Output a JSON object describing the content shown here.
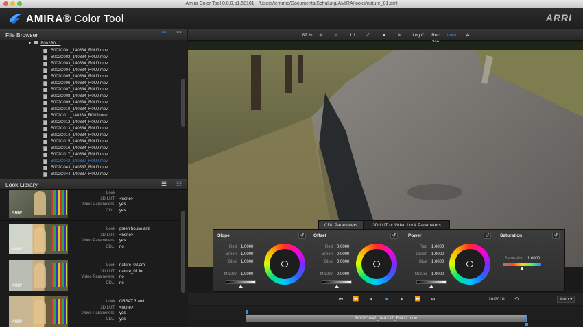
{
  "window": {
    "title": "Amira Color Tool 0.0.0.b1.58101 - /Users/temmie/Documents/Schulung/AMIRA/looks/nature_01.aml"
  },
  "brand": {
    "name_bold": "AMIRA",
    "name_reg": "® Color Tool",
    "vendor": "ARRI"
  },
  "file_browser": {
    "title": "File Browser",
    "folder": "B002R0UJ",
    "files": [
      {
        "name": "B002C001_140334_R0UJ.mov",
        "selected": false
      },
      {
        "name": "B002C002_140334_R0UJ.mov",
        "selected": false
      },
      {
        "name": "B002C003_140334_R0UJ.mov",
        "selected": false
      },
      {
        "name": "B002C004_140334_R0UJ.mov",
        "selected": false
      },
      {
        "name": "B002C005_140334_R0UJ.mov",
        "selected": false
      },
      {
        "name": "B002C006_140334_R0UJ.mov",
        "selected": false
      },
      {
        "name": "B002C007_140334_R0UJ.mov",
        "selected": false
      },
      {
        "name": "B002C008_140334_R0UJ.mov",
        "selected": false
      },
      {
        "name": "B002C009_140334_R0UJ.mov",
        "selected": false
      },
      {
        "name": "B002C010_140334_R0UJ.mov",
        "selected": false
      },
      {
        "name": "B002C011_140334_R0UJ.mov",
        "selected": false
      },
      {
        "name": "B002C012_140334_R0UJ.mov",
        "selected": false
      },
      {
        "name": "B002C013_140334_R0UJ.mov",
        "selected": false
      },
      {
        "name": "B002C014_140334_R0UJ.mov",
        "selected": false
      },
      {
        "name": "B002C015_140334_R0UJ.mov",
        "selected": false
      },
      {
        "name": "B002C016_140334_R0UJ.mov",
        "selected": false
      },
      {
        "name": "B002C017_140334_R0UJ.mov",
        "selected": false
      },
      {
        "name": "B002C042_140337_R0UJ.mov",
        "selected": true
      },
      {
        "name": "B002C043_140337_R0UJ.mov",
        "selected": false
      },
      {
        "name": "B002C044_140337_R0UJ.mov",
        "selected": false
      },
      {
        "name": "B002C045_140337_R0UJ.mov",
        "selected": false
      }
    ]
  },
  "look_library": {
    "title": "Look Library",
    "keys": {
      "look": "Look",
      "lut": "3D LUT:",
      "video": "Video Parameters:",
      "cdl": "CDL:"
    },
    "items": [
      {
        "look": "",
        "lut": "<none>",
        "video": "yes",
        "cdl": "yes"
      },
      {
        "look": "green house.aml",
        "lut": "<none>",
        "video": "yes",
        "cdl": "no"
      },
      {
        "look": "nature_02.aml",
        "lut": "nature_01.lut",
        "video": "no",
        "cdl": "no"
      },
      {
        "look": "OBSAT 3.aml",
        "lut": "<none>",
        "video": "yes",
        "cdl": "yes"
      }
    ]
  },
  "toolbar": {
    "zoom": "87 %",
    "ratio": "1:1",
    "logc": "Log C",
    "rec709": "Rec 709",
    "look": "Look"
  },
  "cdl": {
    "tab_active": "CDL Parameters",
    "tab_inactive": "3D LUT or Video Look Parameters",
    "slope": {
      "title": "Slope",
      "red_label": "Red",
      "red": "1.0000",
      "green_label": "Green",
      "green": "1.0000",
      "blue_label": "Blue",
      "blue": "1.0000",
      "master_label": "Master",
      "master": "1.0000"
    },
    "offset": {
      "title": "Offset",
      "red_label": "Red",
      "red": "0.0000",
      "green_label": "Green",
      "green": "0.0000",
      "blue_label": "Blue",
      "blue": "0.0000",
      "master_label": "Master",
      "master": "0.0000"
    },
    "power": {
      "title": "Power",
      "red_label": "Red",
      "red": "1.0000",
      "green_label": "Green",
      "green": "1.0000",
      "blue_label": "Blue",
      "blue": "1.0000",
      "master_label": "Master",
      "master": "1.0000"
    },
    "saturation": {
      "title": "Saturation",
      "label": "Saturation",
      "value": "1.0000"
    }
  },
  "transport": {
    "frame": "10/2010",
    "mode": "Auto"
  },
  "timeline": {
    "clip_name": "B002C042_140337_R0UJ.mov"
  },
  "colors": {
    "accent": "#3a8ee6",
    "panel": "#2e2e2e"
  }
}
